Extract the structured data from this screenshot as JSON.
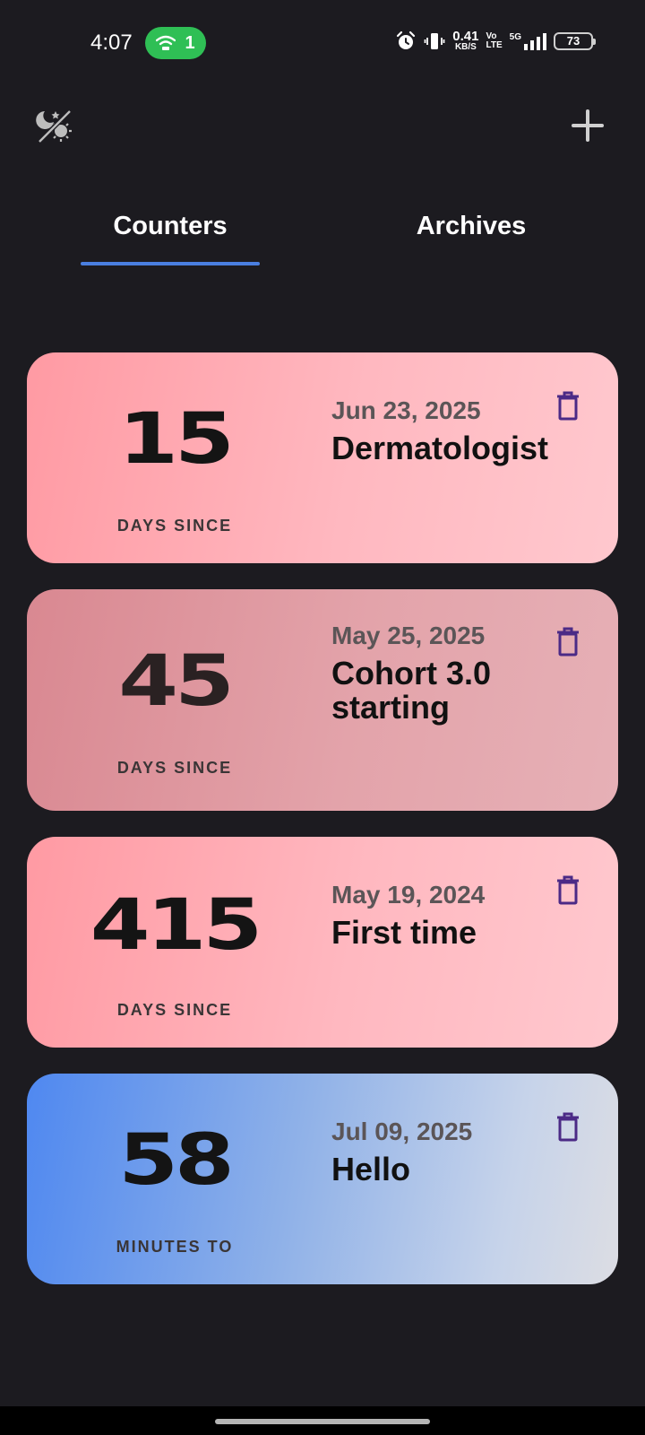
{
  "status_bar": {
    "time": "4:07",
    "wifi_count": "1",
    "net_speed_value": "0.41",
    "net_speed_unit": "KB/S",
    "volte_top": "Vo",
    "volte_bottom": "LTE",
    "network": "5G",
    "battery": "73",
    "icons": [
      "alarm-icon",
      "vibrate-icon",
      "signal-icon",
      "battery-icon"
    ]
  },
  "toolbar": {
    "theme_icon": "theme-toggle-icon",
    "add_icon": "plus-icon"
  },
  "tabs": [
    {
      "label": "Counters",
      "active": true
    },
    {
      "label": "Archives",
      "active": false
    }
  ],
  "counters": [
    {
      "count": "15",
      "unit_label": "DAYS SINCE",
      "date": "Jun 23, 2025",
      "title": "Dermatologist",
      "theme": "pink"
    },
    {
      "count": "45",
      "unit_label": "DAYS SINCE",
      "date": "May 25, 2025",
      "title": "Cohort 3.0 starting",
      "theme": "rose"
    },
    {
      "count": "415",
      "unit_label": "DAYS SINCE",
      "date": "May 19, 2024",
      "title": "First time",
      "theme": "pink"
    },
    {
      "count": "58",
      "unit_label": "MINUTES TO",
      "date": "Jul 09, 2025",
      "title": "Hello",
      "theme": "blue"
    }
  ],
  "colors": {
    "background": "#1c1b20",
    "tab_indicator": "#4a7fe0",
    "delete_icon": "#4b2a86",
    "wifi_pill": "#2fbf55"
  }
}
